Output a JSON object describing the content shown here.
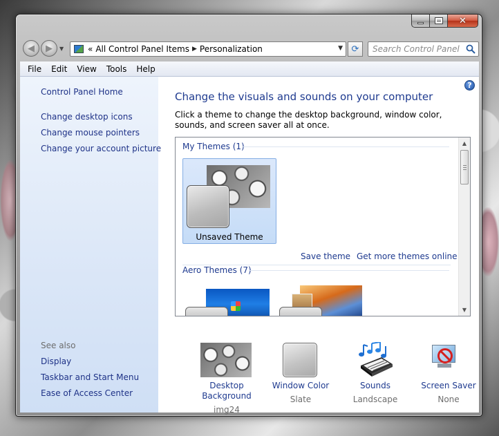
{
  "window": {
    "close_glyph": "✕"
  },
  "nav": {
    "back_glyph": "◀",
    "forward_glyph": "▶",
    "breadcrumb_prefix": "«",
    "breadcrumb": [
      "All Control Panel Items",
      "Personalization"
    ],
    "search_placeholder": "Search Control Panel"
  },
  "menu": [
    "File",
    "Edit",
    "View",
    "Tools",
    "Help"
  ],
  "left_pane": {
    "home": "Control Panel Home",
    "links": [
      "Change desktop icons",
      "Change mouse pointers",
      "Change your account picture"
    ],
    "see_also_label": "See also",
    "see_also": [
      "Display",
      "Taskbar and Start Menu",
      "Ease of Access Center"
    ]
  },
  "main": {
    "help_glyph": "?",
    "title": "Change the visuals and sounds on your computer",
    "description": "Click a theme to change the desktop background, window color, sounds, and screen saver all at once.",
    "my_themes_header": "My Themes (1)",
    "unsaved_theme": "Unsaved Theme",
    "save_theme": "Save theme",
    "get_more_themes": "Get more themes online",
    "aero_themes_header": "Aero Themes (7)"
  },
  "bottom": {
    "desktop_background": {
      "label": "Desktop Background",
      "value": "img24"
    },
    "window_color": {
      "label": "Window Color",
      "value": "Slate"
    },
    "sounds": {
      "label": "Sounds",
      "value": "Landscape"
    },
    "screen_saver": {
      "label": "Screen Saver",
      "value": "None"
    }
  }
}
